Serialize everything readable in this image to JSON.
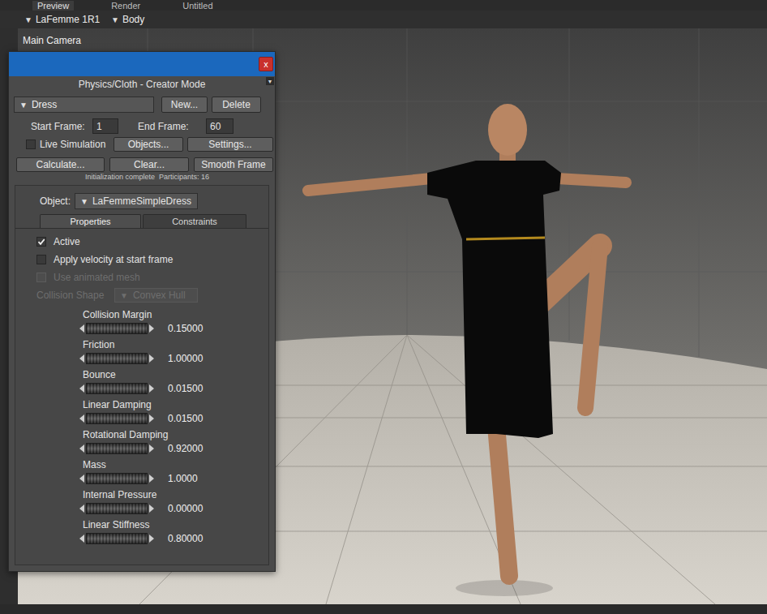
{
  "arrow": "▼",
  "top_tabs": [
    {
      "label": "Preview",
      "selected": true
    },
    {
      "label": "Render",
      "selected": false
    },
    {
      "label": "Untitled",
      "selected": false
    }
  ],
  "toolbar": {
    "figure": "LaFemme 1R1",
    "part": "Body"
  },
  "viewport": {
    "camera": "Main Camera"
  },
  "panel": {
    "title": "Physics/Cloth - Creator Mode",
    "close": "x",
    "simulation": "Dress",
    "buttons_top": [
      "New...",
      "Delete"
    ],
    "start_frame_label": "Start Frame:",
    "start_frame": "1",
    "end_frame_label": "End Frame:",
    "end_frame": "60",
    "live_simulation": {
      "label": "Live Simulation",
      "checked": false
    },
    "buttons_mid": [
      "Objects...",
      "Settings..."
    ],
    "buttons_action": [
      "Calculate...",
      "Clear...",
      "Smooth Frame"
    ],
    "status": "Initialization complete  Participants: 16",
    "object_label": "Object:",
    "object": "LaFemmeSimpleDress",
    "tabs": [
      {
        "label": "Properties",
        "selected": true
      },
      {
        "label": "Constraints",
        "selected": false
      }
    ],
    "options": [
      {
        "label": "Active",
        "checked": true,
        "disabled": false
      },
      {
        "label": "Apply velocity at start frame",
        "checked": false,
        "disabled": false
      },
      {
        "label": "Use animated mesh",
        "checked": false,
        "disabled": true
      }
    ],
    "collision_shape": {
      "label": "Collision Shape",
      "value": "Convex Hull",
      "disabled": true
    },
    "params": [
      {
        "label": "Collision Margin",
        "value": "0.15000"
      },
      {
        "label": "Friction",
        "value": "1.00000"
      },
      {
        "label": "Bounce",
        "value": "0.01500"
      },
      {
        "label": "Linear Damping",
        "value": "0.01500"
      },
      {
        "label": "Rotational Damping",
        "value": "0.92000"
      },
      {
        "label": "Mass",
        "value": "1.0000"
      },
      {
        "label": "Internal Pressure",
        "value": "0.00000"
      },
      {
        "label": "Linear Stiffness",
        "value": "0.80000"
      }
    ]
  }
}
